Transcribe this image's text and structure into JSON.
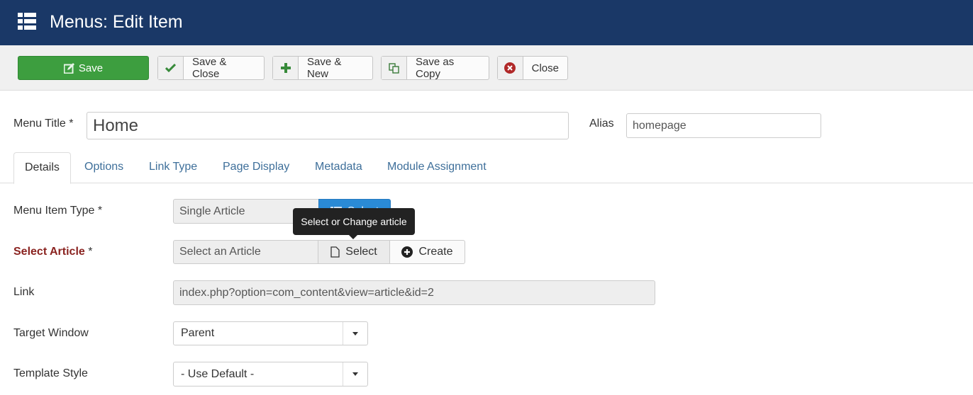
{
  "header": {
    "title": "Menus: Edit Item",
    "icon": "list-icon"
  },
  "toolbar": {
    "save": {
      "label": "Save",
      "icon": "edit-icon"
    },
    "save_close": {
      "label": "Save & Close",
      "icon": "check-icon"
    },
    "save_new": {
      "label": "Save & New",
      "icon": "plus-icon"
    },
    "save_copy": {
      "label": "Save as Copy",
      "icon": "copy-icon"
    },
    "close": {
      "label": "Close",
      "icon": "close-circle-icon"
    }
  },
  "form": {
    "menu_title": {
      "label": "Menu Title *",
      "value": "Home"
    },
    "alias": {
      "label": "Alias",
      "value": "homepage"
    }
  },
  "tabs": [
    {
      "label": "Details",
      "active": true
    },
    {
      "label": "Options"
    },
    {
      "label": "Link Type"
    },
    {
      "label": "Page Display"
    },
    {
      "label": "Metadata"
    },
    {
      "label": "Module Assignment"
    }
  ],
  "details": {
    "menu_item_type": {
      "label": "Menu Item Type *",
      "value": "Single Article",
      "button": "Select"
    },
    "select_article": {
      "label": "Select Article",
      "required_mark": " *",
      "placeholder": "Select an Article",
      "select_button": "Select",
      "create_button": "Create"
    },
    "tooltip": "Select or Change article",
    "link": {
      "label": "Link",
      "value": "index.php?option=com_content&view=article&id=2"
    },
    "target_window": {
      "label": "Target Window",
      "value": "Parent"
    },
    "template_style": {
      "label": "Template Style",
      "value": "- Use Default -"
    }
  },
  "colors": {
    "header_bg": "#1a3867",
    "save_green": "#3d9e3f",
    "required_red": "#8a2320",
    "select_blue": "#2a8ad6"
  }
}
